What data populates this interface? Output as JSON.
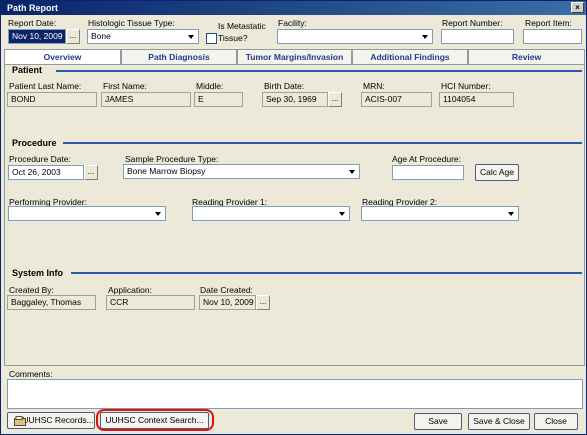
{
  "window": {
    "title": "Path Report",
    "close_label": "×"
  },
  "header": {
    "report_date_label": "Report Date:",
    "report_date_value": "Nov 10, 2009",
    "dots_label": "...",
    "tissue_type_label": "Histologic Tissue Type:",
    "tissue_type_value": "Bone",
    "metastatic_label_1": "Is Metastatic",
    "metastatic_label_2": "Tissue?",
    "facility_label": "Facility:",
    "facility_value": "",
    "report_number_label": "Report Number:",
    "report_number_value": "",
    "report_item_label": "Report Item:",
    "report_item_value": ""
  },
  "tabs": [
    {
      "label": "Overview"
    },
    {
      "label": "Path Diagnosis"
    },
    {
      "label": "Tumor Margins/Invasion"
    },
    {
      "label": "Additional Findings"
    },
    {
      "label": "Review"
    }
  ],
  "patient": {
    "section_title": "Patient",
    "last_name_label": "Patient Last Name:",
    "last_name_value": "BOND",
    "first_name_label": "First Name:",
    "first_name_value": "JAMES",
    "middle_label": "Middle:",
    "middle_value": "E",
    "birth_date_label": "Birth Date:",
    "birth_date_value": "Sep 30, 1969",
    "mrn_label": "MRN:",
    "mrn_value": "ACIS-007",
    "hci_label": "HCI Number:",
    "hci_value": "1104054"
  },
  "procedure": {
    "section_title": "Procedure",
    "date_label": "Procedure Date:",
    "date_value": "Oct 26, 2003",
    "type_label": "Sample Procedure Type:",
    "type_value": "Bone Marrow Biopsy",
    "age_label": "Age At Procedure:",
    "age_value": "",
    "calc_age_label": "Calc Age",
    "performing_label": "Performing Provider:",
    "performing_value": "",
    "reading1_label": "Reading Provider 1:",
    "reading1_value": "",
    "reading2_label": "Reading Provider 2:",
    "reading2_value": ""
  },
  "system_info": {
    "section_title": "System Info",
    "created_by_label": "Created By:",
    "created_by_value": "Baggaley, Thomas",
    "application_label": "Application:",
    "application_value": "CCR",
    "date_created_label": "Date Created:",
    "date_created_value": "Nov 10, 2009"
  },
  "comments": {
    "label": "Comments:",
    "value": ""
  },
  "footer": {
    "records_label": "UUHSC Records...",
    "context_search_label": "UUHSC Context Search...",
    "save_label": "Save",
    "save_close_label": "Save & Close",
    "close_label": "Close"
  },
  "colors": {
    "accent": "#2b57a8",
    "highlight": "#e01010",
    "titlebar": "#0a246a"
  }
}
